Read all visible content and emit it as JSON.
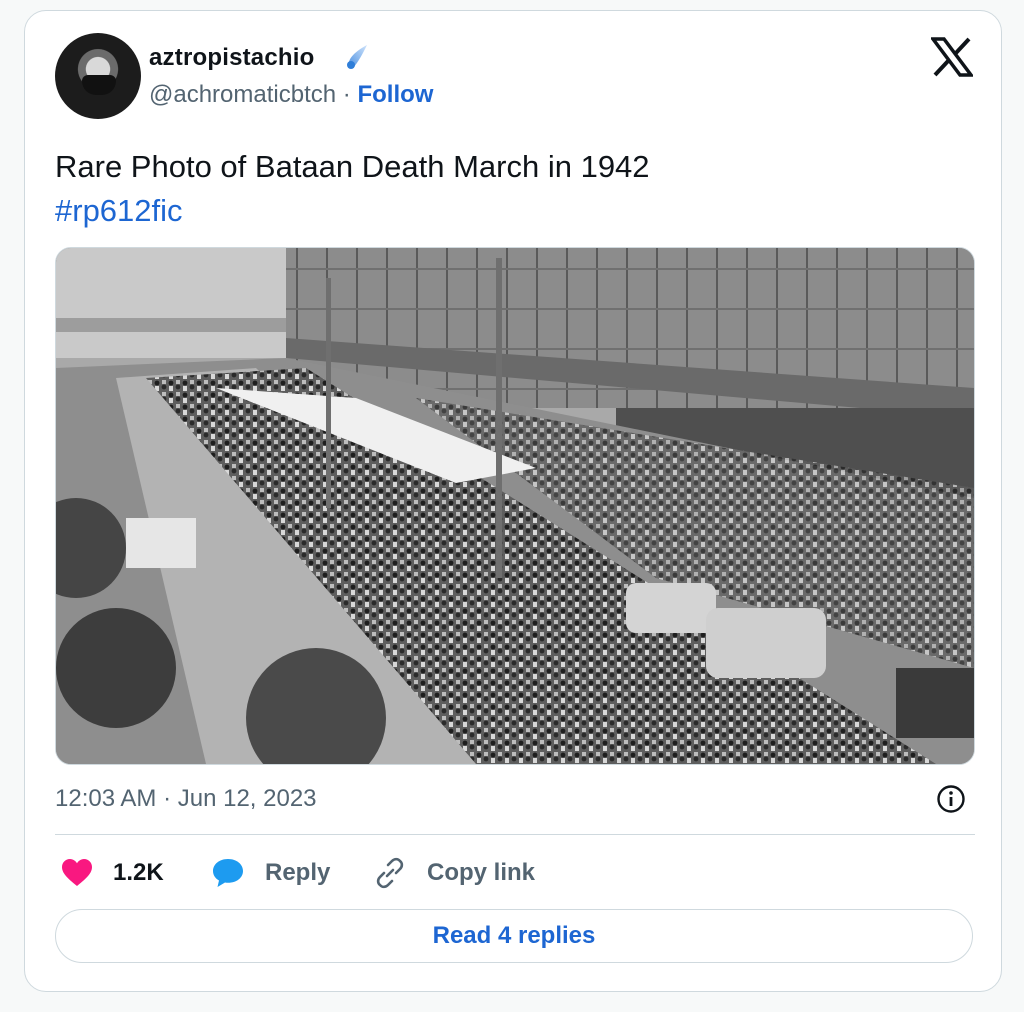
{
  "author": {
    "display_name": "aztropistachio",
    "handle": "@achromaticbtch",
    "separator": "·",
    "follow_label": "Follow"
  },
  "tweet": {
    "text": "Rare Photo of Bataan Death March in 1942",
    "hashtag": "#rp612fic",
    "timestamp": "12:03 AM · Jun 12, 2023"
  },
  "actions": {
    "like_count": "1.2K",
    "reply_label": "Reply",
    "copy_label": "Copy link"
  },
  "read_replies_label": "Read 4 replies",
  "icons": {
    "badge": "comet-badge-icon",
    "logo": "x-logo-icon",
    "info": "info-icon",
    "like": "heart-icon",
    "reply": "speech-bubble-icon",
    "copy": "link-icon"
  },
  "colors": {
    "link": "#1d66d2",
    "like": "#f91880",
    "secondary_text": "#536471",
    "border": "#cfd9de"
  }
}
